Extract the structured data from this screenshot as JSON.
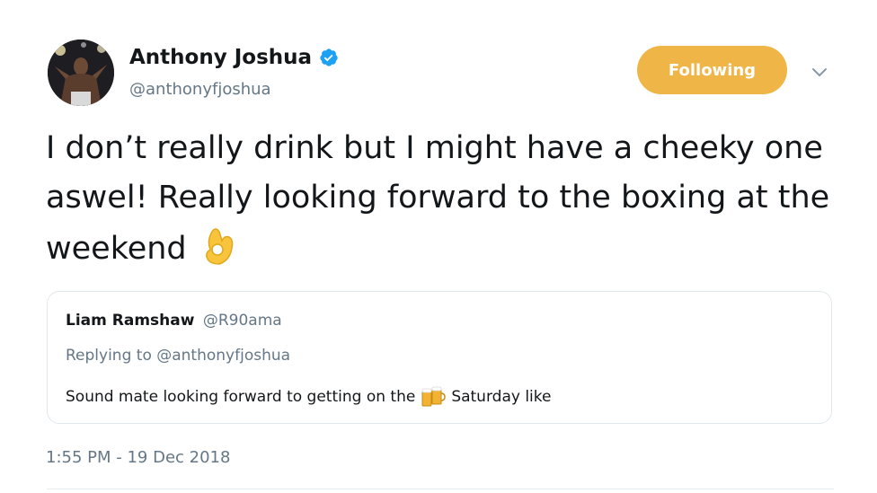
{
  "author": {
    "display_name": "Anthony Joshua",
    "handle": "@anthonyfjoshua",
    "verified": true
  },
  "follow_button": {
    "label": "Following",
    "color": "#f0b547"
  },
  "tweet": {
    "text": "I don’t really drink but I might have a cheeky one aswel! Really looking forward to the boxing at the weekend",
    "emoji": "ok-hand-icon",
    "timestamp": "1:55 PM - 19 Dec 2018"
  },
  "quoted_tweet": {
    "author_name": "Liam Ramshaw",
    "author_handle": "@R90ama",
    "replying_to": "Replying to @anthonyfjoshua",
    "text_before_emoji": "Sound mate looking forward to getting on the",
    "emoji": "beer-mugs-icon",
    "text_after_emoji": "Saturday like"
  },
  "colors": {
    "verified_badge": "#1da1f2",
    "secondary_text": "#657786",
    "primary_text": "#14171a",
    "border": "#e1e8ed"
  }
}
